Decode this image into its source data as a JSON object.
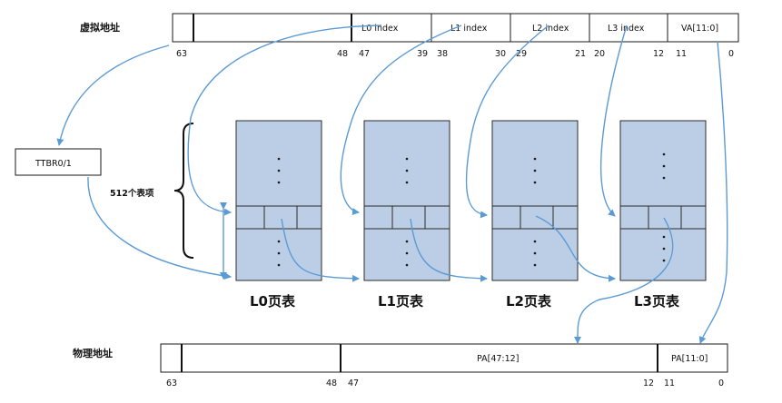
{
  "virtual_address": {
    "label": "虚拟地址",
    "fields": [
      "L0 index",
      "L1 index",
      "L2 index",
      "L3 index",
      "VA[11:0]"
    ],
    "bits": [
      "63",
      "48",
      "47",
      "39",
      "38",
      "30",
      "29",
      "21",
      "20",
      "12",
      "11",
      "0"
    ]
  },
  "ttbr": {
    "label": "TTBR0/1"
  },
  "entries": {
    "label": "512个表项"
  },
  "tables": [
    "L0页表",
    "L1页表",
    "L2页表",
    "L3页表"
  ],
  "physical_address": {
    "label": "物理地址",
    "fields": [
      "PA[47:12]",
      "PA[11:0]"
    ],
    "bits": [
      "63",
      "48",
      "47",
      "12",
      "11",
      "0"
    ]
  },
  "colors": {
    "arrow": "#5b9bd5",
    "table_fill": "#bccde6"
  }
}
